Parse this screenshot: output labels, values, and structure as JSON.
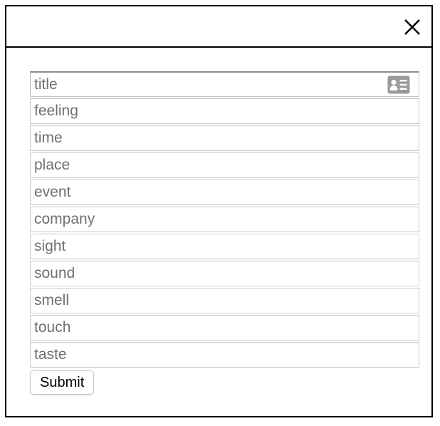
{
  "dialog": {
    "close_icon": "close-icon"
  },
  "form": {
    "fields": [
      {
        "name": "title",
        "placeholder": "title",
        "value": ""
      },
      {
        "name": "feeling",
        "placeholder": "feeling",
        "value": ""
      },
      {
        "name": "time",
        "placeholder": "time",
        "value": ""
      },
      {
        "name": "place",
        "placeholder": "place",
        "value": ""
      },
      {
        "name": "event",
        "placeholder": "event",
        "value": ""
      },
      {
        "name": "company",
        "placeholder": "company",
        "value": ""
      },
      {
        "name": "sight",
        "placeholder": "sight",
        "value": ""
      },
      {
        "name": "sound",
        "placeholder": "sound",
        "value": ""
      },
      {
        "name": "smell",
        "placeholder": "smell",
        "value": ""
      },
      {
        "name": "touch",
        "placeholder": "touch",
        "value": ""
      },
      {
        "name": "taste",
        "placeholder": "taste",
        "value": ""
      }
    ],
    "autofill_icon": "contact-card-icon",
    "submit_label": "Submit"
  }
}
